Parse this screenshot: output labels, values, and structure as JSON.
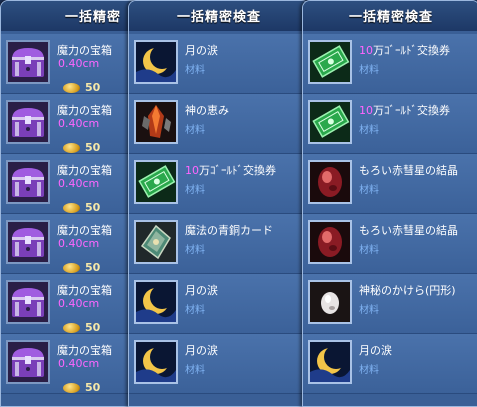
{
  "panels": [
    {
      "title": "一括精密",
      "rows": [
        {
          "icon": "purple-treasure-chest-icon",
          "name": "魔力の宝箱",
          "sub": "0.40cm",
          "count": "50"
        },
        {
          "icon": "purple-treasure-chest-icon",
          "name": "魔力の宝箱",
          "sub": "0.40cm",
          "count": "50"
        },
        {
          "icon": "purple-treasure-chest-icon",
          "name": "魔力の宝箱",
          "sub": "0.40cm",
          "count": "50"
        },
        {
          "icon": "purple-treasure-chest-icon",
          "name": "魔力の宝箱",
          "sub": "0.40cm",
          "count": "50"
        },
        {
          "icon": "purple-treasure-chest-icon",
          "name": "魔力の宝箱",
          "sub": "0.40cm",
          "count": "50"
        },
        {
          "icon": "purple-treasure-chest-icon",
          "name": "魔力の宝箱",
          "sub": "0.40cm",
          "count": "50"
        }
      ]
    },
    {
      "title": "一括精密検査",
      "rows": [
        {
          "icon": "crescent-moon-icon",
          "name": "月の涙",
          "category": "材料"
        },
        {
          "icon": "red-crystal-blessing-icon",
          "name": "神の恵み",
          "category": "材料"
        },
        {
          "icon": "green-gold-voucher-icon",
          "name_prefix": "10",
          "name": "万ｺﾞｰﾙﾄﾞ交換券",
          "category": "材料"
        },
        {
          "icon": "bronze-card-icon",
          "name": "魔法の青銅カード",
          "category": "材料"
        },
        {
          "icon": "crescent-moon-icon",
          "name": "月の涙",
          "category": "材料"
        },
        {
          "icon": "crescent-moon-icon",
          "name": "月の涙",
          "category": "材料"
        }
      ]
    },
    {
      "title": "一括精密検査",
      "rows": [
        {
          "icon": "green-gold-voucher-icon",
          "name_prefix": "10",
          "name": "万ｺﾞｰﾙﾄﾞ交換券",
          "category": "材料"
        },
        {
          "icon": "green-gold-voucher-icon",
          "name_prefix": "10",
          "name": "万ｺﾞｰﾙﾄﾞ交換券",
          "category": "材料"
        },
        {
          "icon": "red-gem-crystal-icon",
          "name": "もろい赤彗星の結晶",
          "category": "材料"
        },
        {
          "icon": "red-gem-crystal-icon",
          "name": "もろい赤彗星の結晶",
          "category": "材料"
        },
        {
          "icon": "mysterious-shard-icon",
          "name": "神秘のかけら(円形)",
          "category": "材料"
        },
        {
          "icon": "crescent-moon-icon",
          "name": "月の涙",
          "category": "材料"
        }
      ]
    }
  ]
}
